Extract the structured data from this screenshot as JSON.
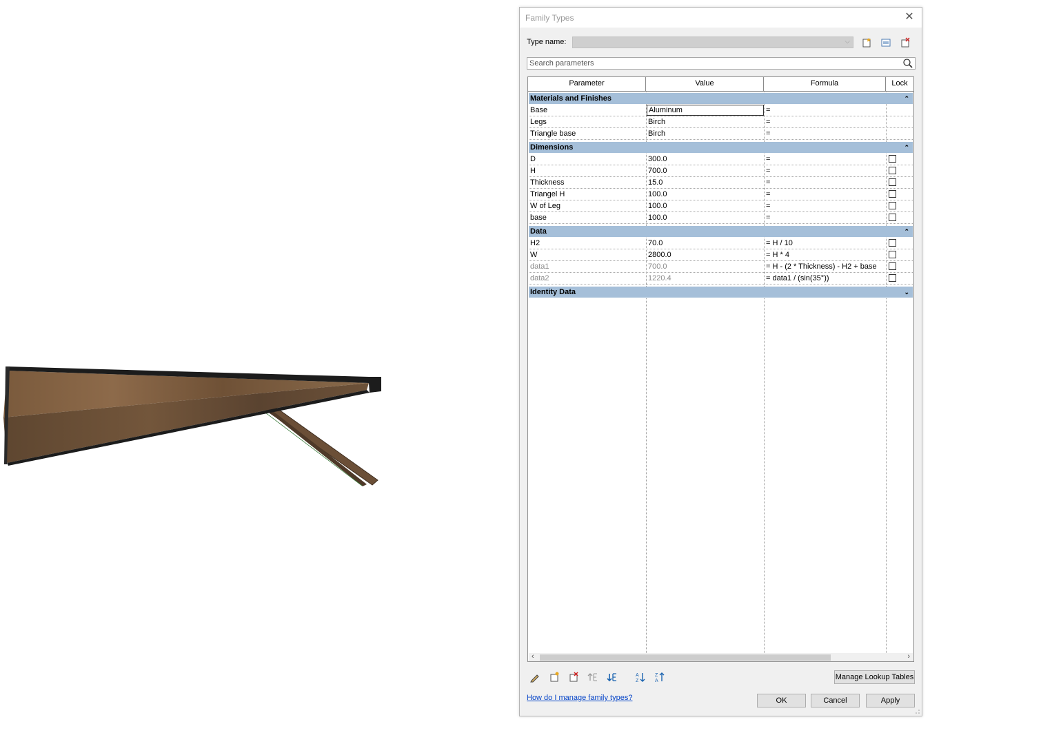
{
  "dialog": {
    "title": "Family Types",
    "type_name_label": "Type name:",
    "type_name_value": "",
    "search_placeholder": "Search parameters",
    "columns": [
      "Parameter",
      "Value",
      "Formula",
      "Lock"
    ],
    "groups": {
      "materials": {
        "label": "Materials and Finishes",
        "rows": [
          {
            "param": "Base",
            "value": "Aluminum",
            "formula": "="
          },
          {
            "param": "Legs",
            "value": "Birch",
            "formula": "="
          },
          {
            "param": "Triangle base",
            "value": "Birch",
            "formula": "="
          }
        ]
      },
      "dimensions": {
        "label": "Dimensions",
        "rows": [
          {
            "param": "D",
            "value": "300.0",
            "formula": "="
          },
          {
            "param": "H",
            "value": "700.0",
            "formula": "="
          },
          {
            "param": "Thickness",
            "value": "15.0",
            "formula": "="
          },
          {
            "param": "Triangel H",
            "value": "100.0",
            "formula": "="
          },
          {
            "param": "W of Leg",
            "value": "100.0",
            "formula": "="
          },
          {
            "param": "base",
            "value": "100.0",
            "formula": "="
          }
        ]
      },
      "data": {
        "label": "Data",
        "rows": [
          {
            "param": "H2",
            "value": "70.0",
            "formula": "= H / 10"
          },
          {
            "param": "W",
            "value": "2800.0",
            "formula": "= H * 4"
          },
          {
            "param": "data1",
            "value": "700.0",
            "formula": "= H - (2 * Thickness) - H2 + base"
          },
          {
            "param": "data2",
            "value": "1220.4",
            "formula": "= data1 / (sin(35°))"
          }
        ]
      },
      "identity": {
        "label": "Identity Data",
        "rows": []
      }
    },
    "manage_lookup_label": "Manage Lookup Tables",
    "help_link": "How do I manage family types?",
    "ok_label": "OK",
    "cancel_label": "Cancel",
    "apply_label": "Apply"
  },
  "colors": {
    "group_header": "#a5bfd9",
    "dialog_bg": "#f0f0f0",
    "link": "#0645c8"
  }
}
